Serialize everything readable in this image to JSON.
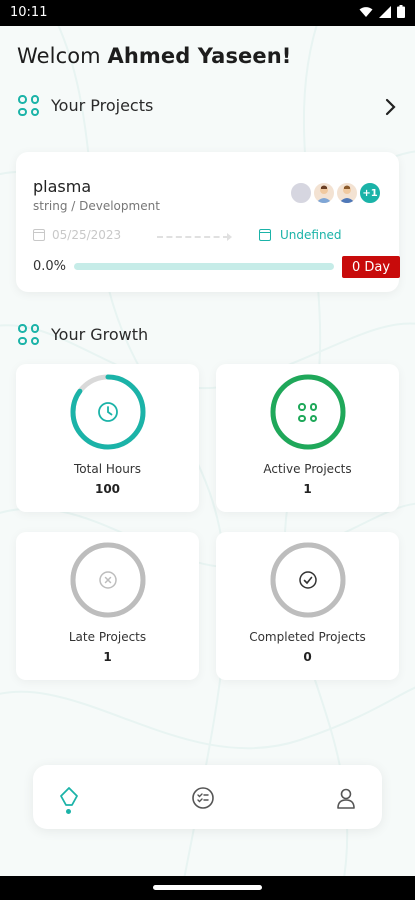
{
  "status_bar": {
    "time": "10:11"
  },
  "header": {
    "welcome_prefix": "Welcom",
    "user_name": "Ahmed Yaseen!"
  },
  "projects_section": {
    "title": "Your Projects"
  },
  "project": {
    "name": "plasma",
    "subtitle": "string / Development",
    "start_date": "05/25/2023",
    "end_date": "Undefined",
    "progress_text": "0.0%",
    "progress": 0.0,
    "days_badge": "0 Day",
    "extra_members": "+1"
  },
  "growth_section": {
    "title": "Your Growth"
  },
  "stats": [
    {
      "label": "Total Hours",
      "value": "100",
      "icon": "clock-icon",
      "color": "#1bb3a8",
      "fill": 0.85
    },
    {
      "label": "Active Projects",
      "value": "1",
      "icon": "grid-icon",
      "color": "#1fa85a",
      "fill": 1.0
    },
    {
      "label": "Late Projects",
      "value": "1",
      "icon": "x-circle-icon",
      "color": "#bdbdbd",
      "fill": 1.0
    },
    {
      "label": "Completed Projects",
      "value": "0",
      "icon": "check-circle-icon",
      "color": "#bdbdbd",
      "fill": 1.0
    }
  ],
  "colors": {
    "accent": "#1bb3a8",
    "active": "#1fa85a",
    "badge": "#c80b0b",
    "inactive": "#bdbdbd"
  },
  "bottom_nav": {
    "items": [
      "home-icon",
      "tasks-icon",
      "profile-icon"
    ],
    "active": 0
  }
}
